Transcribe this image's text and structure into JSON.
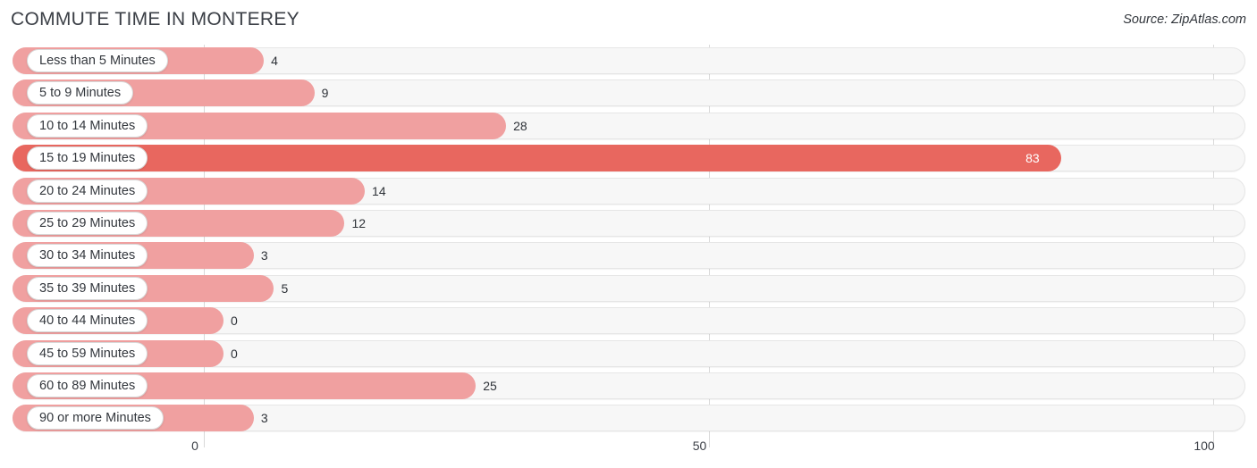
{
  "header": {
    "title": "COMMUTE TIME IN MONTEREY",
    "source": "Source: ZipAtlas.com"
  },
  "chart_data": {
    "type": "bar",
    "orientation": "horizontal",
    "title": "COMMUTE TIME IN MONTEREY",
    "subtitle": "Source: ZipAtlas.com",
    "xlabel": "",
    "ylabel": "",
    "xlim": [
      0,
      100
    ],
    "grid": true,
    "legend": false,
    "highlight_color": "#e8675f",
    "bar_color": "#f0a0a0",
    "categories": [
      "Less than 5 Minutes",
      "5 to 9 Minutes",
      "10 to 14 Minutes",
      "15 to 19 Minutes",
      "20 to 24 Minutes",
      "25 to 29 Minutes",
      "30 to 34 Minutes",
      "35 to 39 Minutes",
      "40 to 44 Minutes",
      "45 to 59 Minutes",
      "60 to 89 Minutes",
      "90 or more Minutes"
    ],
    "values": [
      4,
      9,
      28,
      83,
      14,
      12,
      3,
      5,
      0,
      0,
      25,
      3
    ],
    "value_labels": [
      "4",
      "9",
      "28",
      "83",
      "14",
      "12",
      "3",
      "5",
      "0",
      "0",
      "25",
      "3"
    ],
    "xticks": [
      0,
      50,
      100
    ],
    "xtick_labels": [
      "0",
      "50",
      "100"
    ]
  }
}
